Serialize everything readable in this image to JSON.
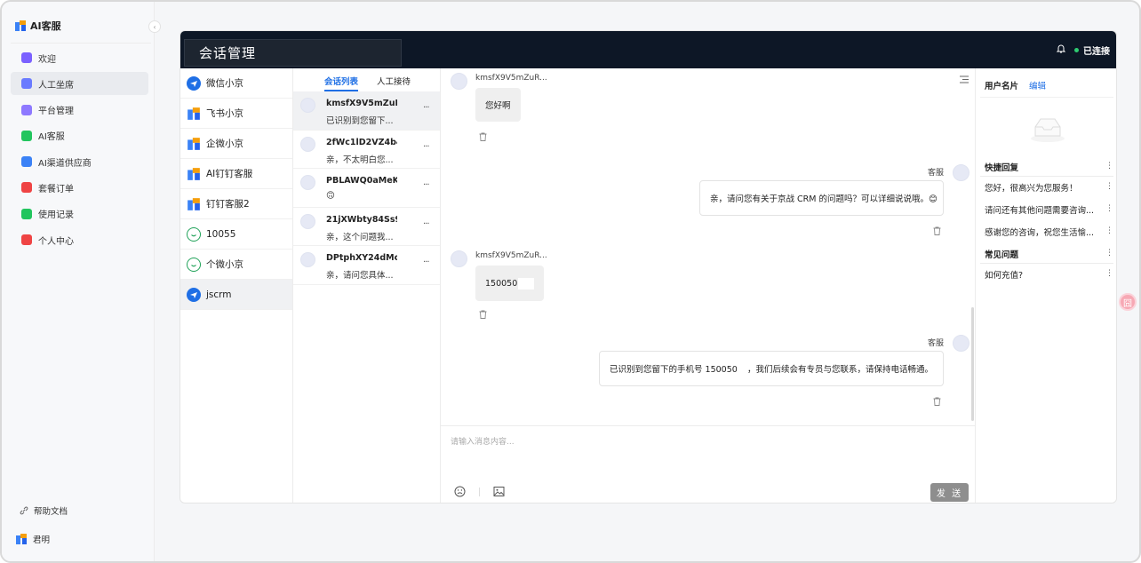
{
  "app": {
    "brand": "AI客服",
    "user_name": "君明",
    "help_label": "帮助文档"
  },
  "nav": [
    {
      "label": "欢迎",
      "icon": "pie-chart-icon",
      "color": "#7b61ff"
    },
    {
      "label": "人工坐席",
      "icon": "person-icon",
      "color": "#6a7bff",
      "active": true
    },
    {
      "label": "平台管理",
      "icon": "hexagon-icon",
      "color": "#8e79ff"
    },
    {
      "label": "AI客服",
      "icon": "robot-icon",
      "color": "#22c55e"
    },
    {
      "label": "AI渠道供应商",
      "icon": "cube-icon",
      "color": "#3b82f6"
    },
    {
      "label": "套餐订单",
      "icon": "order-icon",
      "color": "#ef4444"
    },
    {
      "label": "使用记录",
      "icon": "record-icon",
      "color": "#22c55e"
    },
    {
      "label": "个人中心",
      "icon": "user-center-icon",
      "color": "#ef4444"
    }
  ],
  "header": {
    "title": "会话管理",
    "status": "已连接"
  },
  "channels": [
    {
      "name": "微信小京",
      "icon": "channel-plane-icon"
    },
    {
      "name": "飞书小京",
      "icon": "channel-logo-icon"
    },
    {
      "name": "企微小京",
      "icon": "channel-logo-icon"
    },
    {
      "name": "AI钉钉客服",
      "icon": "channel-logo-icon"
    },
    {
      "name": "钉钉客服2",
      "icon": "channel-logo-icon"
    },
    {
      "name": "10055",
      "icon": "channel-smile-icon"
    },
    {
      "name": "个微小京",
      "icon": "channel-smile-icon"
    },
    {
      "name": "jscrm",
      "icon": "channel-plane-icon",
      "active": true
    }
  ],
  "conv_tabs": [
    "会话列表",
    "人工接待"
  ],
  "conversations": [
    {
      "name": "kmsfX9V5mZuR...",
      "last": "已识别到您留下...",
      "active": true
    },
    {
      "name": "2fWc1lD2VZ4b4...",
      "last": "亲，不太明白您..."
    },
    {
      "name": "PBLAWQ0aMeK...",
      "last": "🙃"
    },
    {
      "name": "21jXWbty84Ss9...",
      "last": "亲，这个问题我..."
    },
    {
      "name": "DPtphXY24dMc...",
      "last": "亲，请问您具体..."
    }
  ],
  "messages": [
    {
      "side": "left",
      "sender": "kmsfX9V5mZuR...",
      "text": "您好啊"
    },
    {
      "side": "right",
      "sender": "客服",
      "text": "亲，请问您有关于京战 CRM 的问题吗？可以详细说说哦。😊"
    },
    {
      "side": "left",
      "sender": "kmsfX9V5mZuR...",
      "text": "150050"
    },
    {
      "side": "right",
      "sender": "客服",
      "text_a": "已识别到您留下的手机号 150050",
      "text_b": "，我们后续会有专员与您联系，请保持电话畅通。"
    }
  ],
  "composer": {
    "placeholder": "请输入消息内容...",
    "send_label": "发 送"
  },
  "panel": {
    "title": "用户名片",
    "edit": "编辑",
    "quick_reply_title": "快捷回复",
    "quick_replies": [
      "您好，很高兴为您服务！",
      "请问还有其他问题需要咨询...",
      "感谢您的咨询，祝您生活愉..."
    ],
    "faq_title": "常见问题",
    "faqs": [
      "如何充值?"
    ]
  },
  "float_badge": "囧"
}
